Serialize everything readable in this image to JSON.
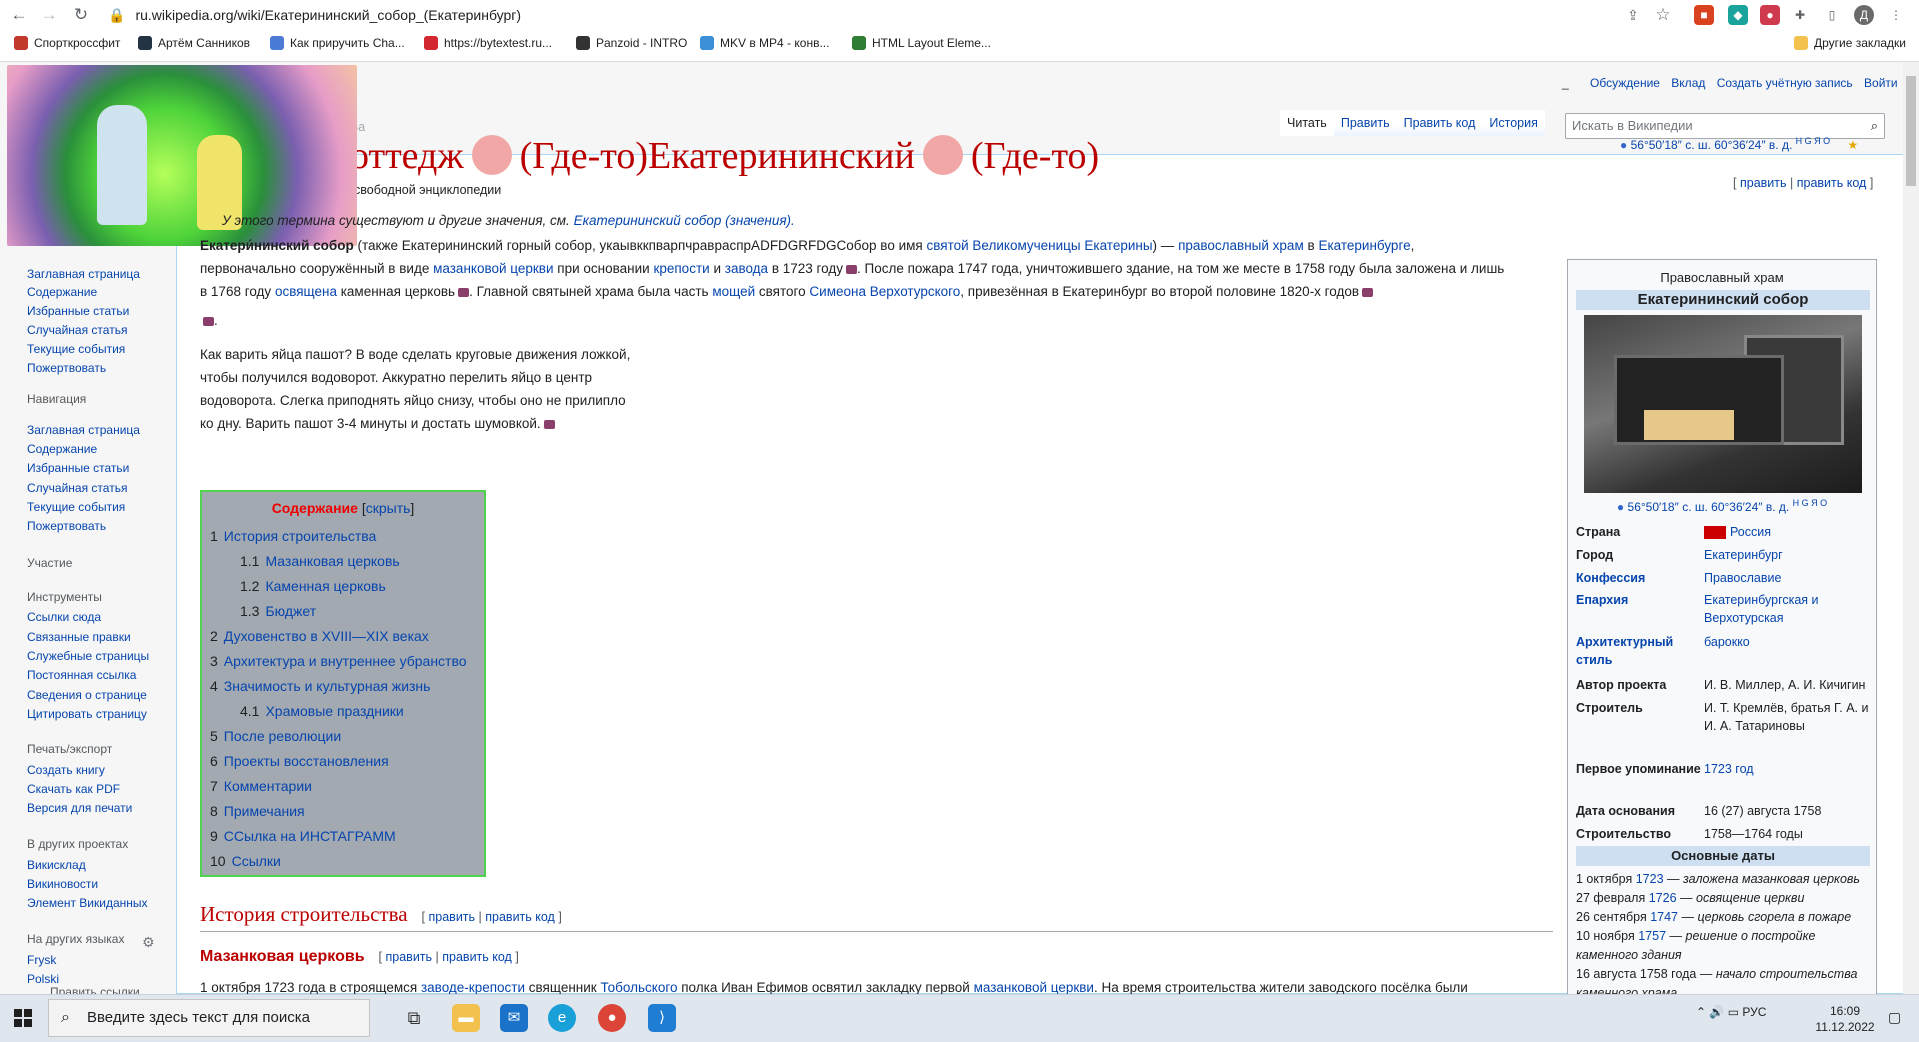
{
  "browser": {
    "url": "ru.wikipedia.org/wiki/Екатерининский_собор_(Екатеринбург)",
    "bookmarks": [
      "Спорткроссфит",
      "Артём Санников",
      "Как приручить Cha...",
      "https://bytextest.ru...",
      "Panzoid - INTRO",
      "MKV в MP4 - конв...",
      "HTML Layout Eleme..."
    ],
    "other_bookmarks": "Другие закладки",
    "profile_initial": "Д"
  },
  "personal": {
    "dash": "_",
    "talk": "Обсуждение",
    "contrib": "Вклад",
    "create": "Создать учётную запись",
    "login": "Войти"
  },
  "tabs": {
    "read": "Читать",
    "edit": "Править",
    "edit_source": "Править код",
    "history": "История",
    "partial": "Ба"
  },
  "search": {
    "placeholder": "Искать в Википедии"
  },
  "title": {
    "part1": "нинский Коттедж",
    "part2": "(Где-то)Екатерининский",
    "part3": "(Где-то)"
  },
  "coords": "56°50′18″ с. ш. 60°36′24″ в. д.",
  "coords_sup": "H G Я O",
  "from_wiki": "свободной энциклопедии",
  "edit_links": {
    "open": "[",
    "edit": "править",
    "sep": "|",
    "edit_source": "править код",
    "close": "]"
  },
  "sidebar": {
    "main": [
      "Заглавная страница",
      "Содержание",
      "Избранные статьи",
      "Случайная статья",
      "Текущие события",
      "Пожертвовать"
    ],
    "nav_title": "Навигация",
    "nav": [
      "Заглавная страница",
      "Содержание",
      "Избранные статьи",
      "Случайная статья",
      "Текущие события",
      "Пожертвовать"
    ],
    "participation": "Участие",
    "tools_title": "Инструменты",
    "tools": [
      "Ссылки сюда",
      "Связанные правки",
      "Служебные страницы",
      "Постоянная ссылка",
      "Сведения о странице",
      "Цитировать страницу"
    ],
    "print_title": "Печать/экспорт",
    "print": [
      "Создать книгу",
      "Скачать как PDF",
      "Версия для печати"
    ],
    "projects_title": "В других проектах",
    "projects": [
      "Викисклад",
      "Викиновости",
      "Элемент Викиданных"
    ],
    "langs_title": "На других языках",
    "langs": [
      "Frysk",
      "Polski"
    ],
    "edit_links": "Править ссылки"
  },
  "article": {
    "hatnote_pre": "У этого термина существуют и другие значения, см.",
    "hatnote_link": "Екатерининский собор (значения).",
    "l1_bold": "Екатери́нинский собор",
    "l1_a": "(также Екатерининский горный собор, укаывккпварпчравраспрADFDGRFDGСобор во имя",
    "l1_link1": "святой Великомученицы Екатерины",
    "l1_b": ") —",
    "l1_link2": "православный храм",
    "l1_c": "в",
    "l1_link3": "Екатеринбурге",
    "l1_d": ",",
    "l2_a": "первоначально сооружённый в виде",
    "l2_link1": "мазанковой церкви",
    "l2_b": "при основании",
    "l2_link2": "крепости",
    "l2_c": "и",
    "l2_link3": "завода",
    "l2_d": "в 1723 году",
    "l2_e": ". После пожара 1747 года, уничтожившего здание, на том же месте в 1758 году была заложена и лишь",
    "l3_a": "в 1768 году",
    "l3_link1": "освящена",
    "l3_b": "каменная церковь",
    "l3_c": ". Главной святыней храма была часть",
    "l3_link2": "мощей",
    "l3_d": "святого",
    "l3_link3": "Симеона Верхотурского",
    "l3_e": ", привезённая в Екатеринбург во второй половине 1820-х годов",
    "dot": ".",
    "egg": [
      "Как варить яйца пашот? В воде сделать круговые движения ложкой,",
      "чтобы получился водоворот. Аккуратно перелить яйцо в центр",
      "водоворота. Слегка приподнять яйцо снизу, чтобы оно не прилипло",
      "ко дну. Варить пашот 3-4 минуты и достать шумовкой."
    ],
    "h2": "История строительства",
    "h3": "Мазанковая церковь",
    "last_a": "1 октября 1723 года в строящемся",
    "last_link1": "заводе-крепости",
    "last_b": "священник",
    "last_link2": "Тобольского",
    "last_c": "полка Иван Ефимов освятил закладку первой",
    "last_link3": "мазанковой церкви",
    "last_d": ". На время строительства жители заводского посёлка были"
  },
  "toc": {
    "title": "Содержание",
    "hide": "скрыть",
    "items": [
      {
        "n": "1",
        "t": "История строительства"
      },
      {
        "n": "1.1",
        "t": "Мазанковая церковь"
      },
      {
        "n": "1.2",
        "t": "Каменная церковь"
      },
      {
        "n": "1.3",
        "t": "Бюджет"
      },
      {
        "n": "2",
        "t": "Духовенство в XVIII—XIX веках"
      },
      {
        "n": "3",
        "t": "Архитектура и внутреннее убранство"
      },
      {
        "n": "4",
        "t": "Значимость и культурная жизнь"
      },
      {
        "n": "4.1",
        "t": "Храмовые праздники"
      },
      {
        "n": "5",
        "t": "После революции"
      },
      {
        "n": "6",
        "t": "Проекты восстановления"
      },
      {
        "n": "7",
        "t": "Комментарии"
      },
      {
        "n": "8",
        "t": "Примечания"
      },
      {
        "n": "9",
        "t": "ССылка на ИНСТАГРАММ"
      },
      {
        "n": "10",
        "t": "Ссылки"
      }
    ]
  },
  "infobox": {
    "type": "Православный храм",
    "name": "Екатерининский собор",
    "rows": [
      {
        "k": "Страна",
        "v": "Россия"
      },
      {
        "k": "Город",
        "v": "Екатеринбург"
      },
      {
        "k": "Конфессия",
        "v": "Православие"
      },
      {
        "k": "Епархия",
        "v": "Екатеринбургская и Верхотурская"
      },
      {
        "k": "Архитектурный стиль",
        "v": "барокко"
      },
      {
        "k": "Автор проекта",
        "v": "И. В. Миллер, А. И. Кичигин"
      },
      {
        "k": "Строитель",
        "v": "И. Т. Кремлёв, братья Г. А. и И. А. Татариновы"
      },
      {
        "k": "Первое упоминание",
        "v": "1723 год"
      },
      {
        "k": "Дата основания",
        "v": "16 (27) августа 1758"
      },
      {
        "k": "Строительство",
        "v": "1758—1764 годы"
      }
    ],
    "dates_title": "Основные даты",
    "dates": [
      {
        "d": "1 октября",
        "y": "1723",
        "t": "— заложена мазанковая церковь"
      },
      {
        "d": "27 февраля",
        "y": "1726",
        "t": "— освящение церкви"
      },
      {
        "d": "26 сентября",
        "y": "1747",
        "t": "— церковь сгорела в пожаре"
      },
      {
        "d": "10 ноября",
        "y": "1757",
        "t": "— решение о постройке"
      },
      {
        "d": "",
        "y": "",
        "t": "каменного здания"
      },
      {
        "d": "16 августа 1758 года",
        "y": "",
        "t": "— начало строительства"
      },
      {
        "d": "",
        "y": "",
        "t": "каменного храма"
      }
    ]
  },
  "taskbar": {
    "search_placeholder": "Введите здесь текст для поиска",
    "lang": "РУС",
    "time": "16:09",
    "date": "11.12.2022"
  }
}
